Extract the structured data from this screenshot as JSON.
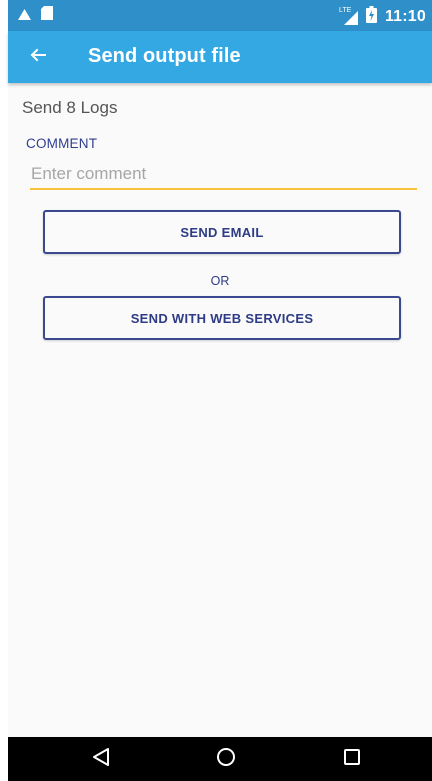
{
  "status_bar": {
    "time": "11:10",
    "network_label": "LTE",
    "icons": [
      "signal-alert-icon",
      "sd-card-icon",
      "lte-signal-icon",
      "battery-icon"
    ]
  },
  "app_bar": {
    "title": "Send output file",
    "back_icon": "arrow-left-icon"
  },
  "content": {
    "heading": "Send 8 Logs",
    "comment_label": "COMMENT",
    "comment_value": "",
    "comment_placeholder": "Enter comment",
    "send_email_label": "SEND EMAIL",
    "or_label": "OR",
    "send_web_label": "SEND WITH WEB SERVICES"
  },
  "nav_bar": {
    "icons": [
      "nav-back-icon",
      "nav-home-icon",
      "nav-recents-icon"
    ]
  },
  "colors": {
    "status_bar": "#2f8fc9",
    "app_bar": "#34a8e2",
    "accent_underline": "#f6c33a",
    "button_text": "#2e3b85",
    "background": "#fafafa"
  }
}
